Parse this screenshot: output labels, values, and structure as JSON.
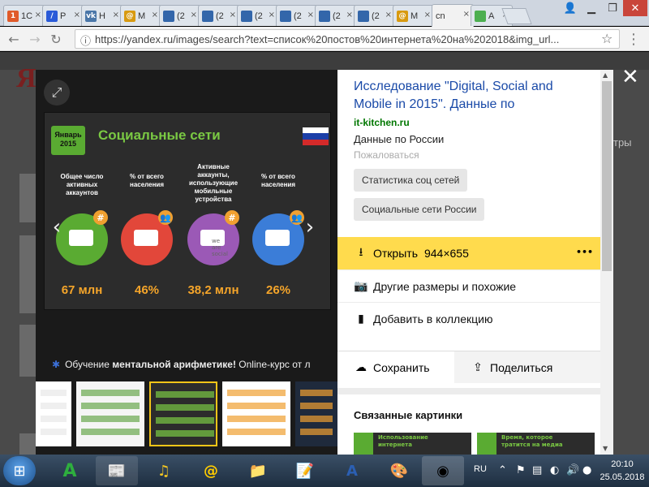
{
  "browser": {
    "tabs": [
      {
        "label": "1C",
        "fav_color": "#e05a2a",
        "fav_glyph": "1"
      },
      {
        "label": "P",
        "fav_color": "#2a5ad8",
        "fav_glyph": "/"
      },
      {
        "label": "H",
        "fav_color": "#4a76a8",
        "fav_glyph": "vk"
      },
      {
        "label": "M",
        "fav_color": "#d89a10",
        "fav_glyph": "@"
      },
      {
        "label": "(2",
        "fav_color": "#3366aa",
        "fav_glyph": ""
      },
      {
        "label": "(2",
        "fav_color": "#3366aa",
        "fav_glyph": ""
      },
      {
        "label": "(2",
        "fav_color": "#3366aa",
        "fav_glyph": ""
      },
      {
        "label": "(2",
        "fav_color": "#3366aa",
        "fav_glyph": ""
      },
      {
        "label": "(2",
        "fav_color": "#3366aa",
        "fav_glyph": ""
      },
      {
        "label": "(2",
        "fav_color": "#3366aa",
        "fav_glyph": ""
      },
      {
        "label": "M",
        "fav_color": "#d89a10",
        "fav_glyph": "@"
      },
      {
        "label": "cn",
        "fav_color": "",
        "fav_glyph": "",
        "active": true
      },
      {
        "label": "A",
        "fav_color": "#4caf50",
        "fav_glyph": ""
      }
    ],
    "url": "https://yandex.ru/images/search?text=список%20постов%20интернета%20на%202018&img_url..."
  },
  "page": {
    "logo_text": "Ян",
    "right_edge_text": "тры"
  },
  "viewer": {
    "slide": {
      "date_label": "Январь 2015",
      "title": "Социальные сети",
      "stats": [
        {
          "label": "Общее число активных аккаунтов",
          "value": "67 млн",
          "color": "#5aab32",
          "badge": "#"
        },
        {
          "label": "% от всего населения",
          "value": "46%",
          "color": "#e2473a",
          "badge": "👥"
        },
        {
          "label": "Активные аккаунты, использующие мобильные устройства",
          "value": "38,2 млн",
          "color": "#9b59b6",
          "badge": "#"
        },
        {
          "label": "% от всего населения",
          "value": "26%",
          "color": "#3b7dd8",
          "badge": "👥"
        }
      ],
      "watermark": "we are social"
    },
    "ad": {
      "prefix": "Обучение ",
      "bold": "ментальной арифметике!",
      "suffix": " Online-курс от л"
    },
    "thumbnails": [
      {
        "bg": "#ffffff",
        "accent": "#e8e8e8"
      },
      {
        "bg": "#f5f5f5",
        "accent": "#6aa84f"
      },
      {
        "bg": "#2c2c2c",
        "accent": "#7ac943",
        "selected": true
      },
      {
        "bg": "#ffffff",
        "accent": "#f0a030"
      },
      {
        "bg": "#1f2a3c",
        "accent": "#f0a030"
      }
    ]
  },
  "panel": {
    "title": "Исследование \"Digital, Social and Mobile in 2015\". Данные по",
    "site": "it-kitchen.ru",
    "description": "Данные по России",
    "complain": "Пожаловаться",
    "chips": [
      "Статистика соц сетей",
      "Социальные сети России"
    ],
    "open_label": "Открыть",
    "open_size": "944×655",
    "more": "•••",
    "actions": [
      "Другие размеры и похожие",
      "Добавить в коллекцию"
    ],
    "save_label": "Сохранить",
    "share_label": "Поделиться",
    "related_heading": "Связанные картинки",
    "related": [
      "Использование интернета",
      "Время, которое тратится на медиа"
    ]
  },
  "taskbar": {
    "language": "RU",
    "time": "20:10",
    "date": "25.05.2018"
  }
}
